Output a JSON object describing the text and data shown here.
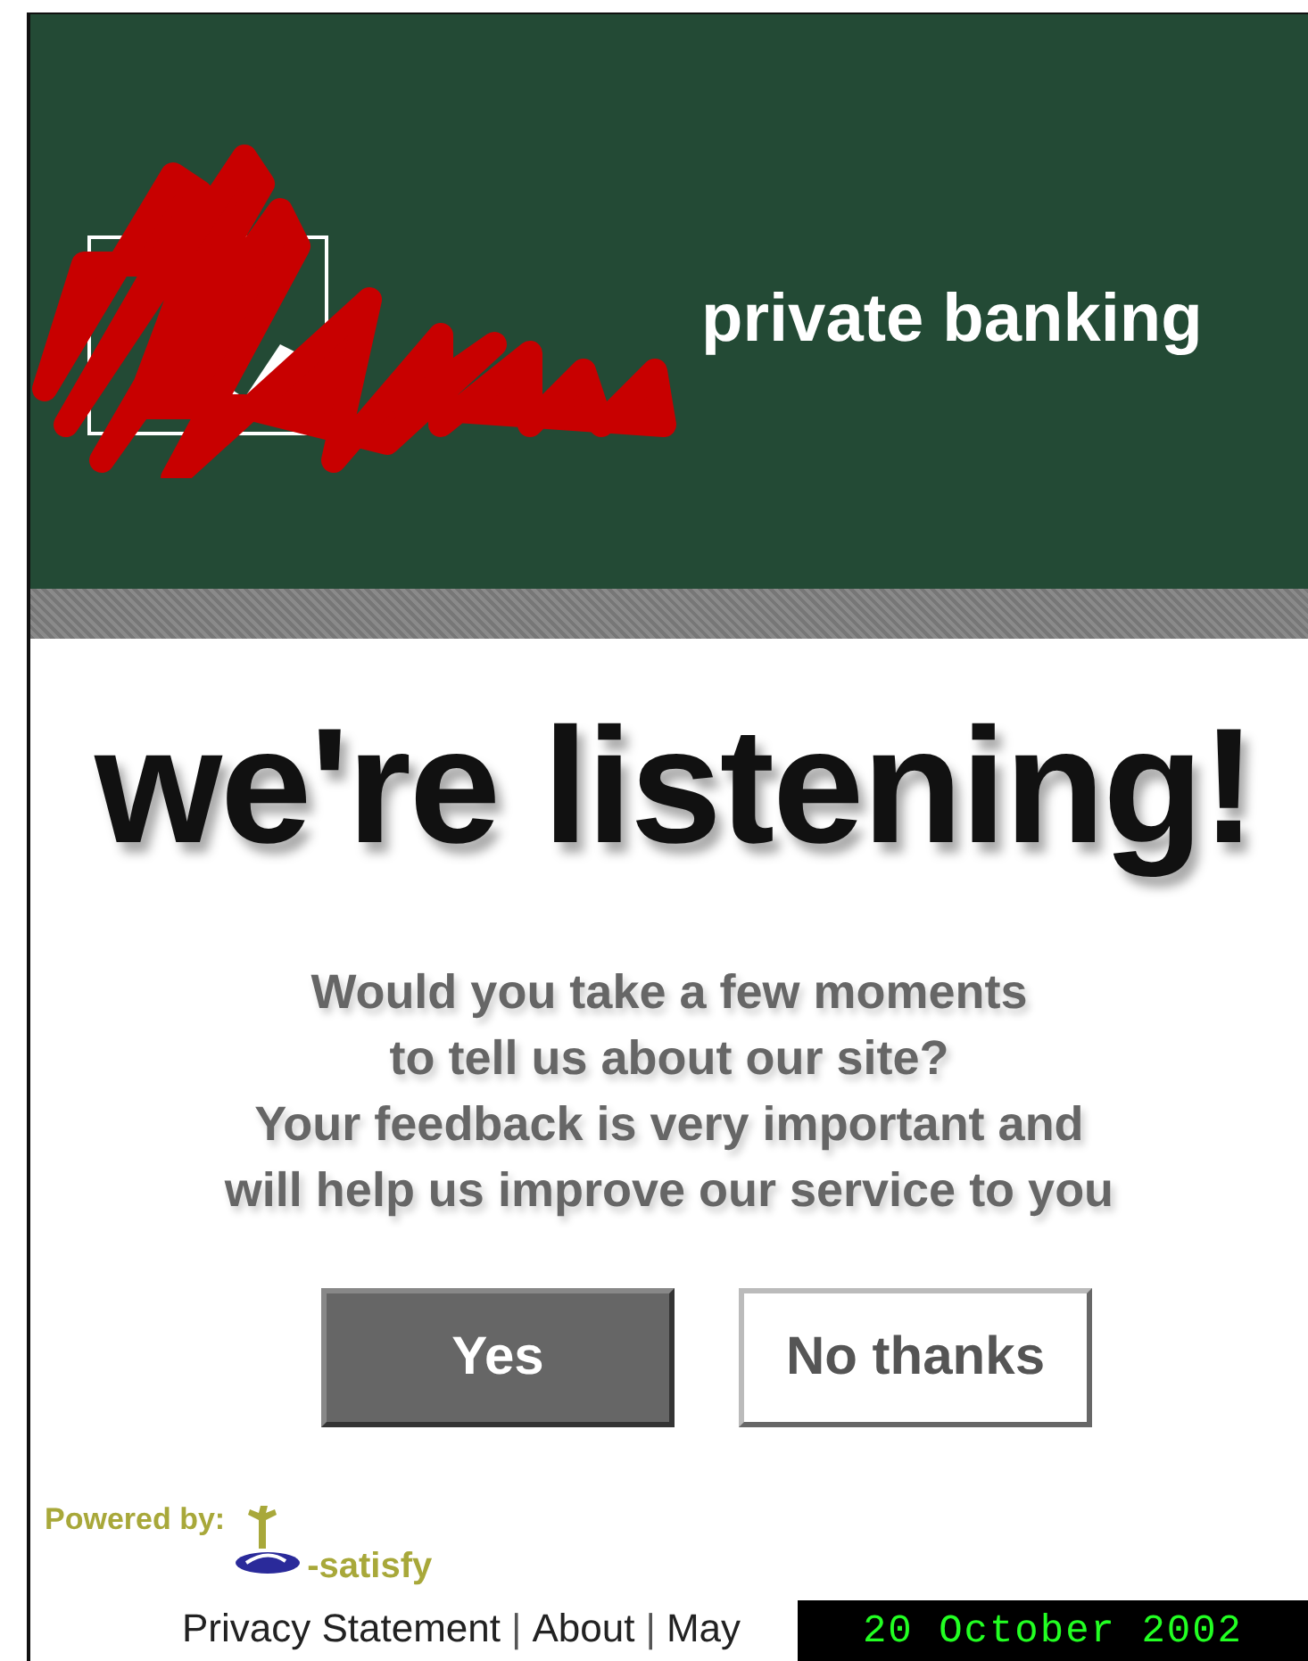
{
  "header": {
    "tagline": "private banking"
  },
  "heading": "we're listening!",
  "message_lines": [
    "Would you take a few moments",
    "to tell us about our site?",
    "Your feedback is very important and",
    "will help us improve our service to you"
  ],
  "buttons": [
    {
      "label": "Yes",
      "kind": "primary"
    },
    {
      "label": "No thanks",
      "kind": "secondary"
    }
  ],
  "powered_by": {
    "label": "Powered by:",
    "brand": "-satisfy"
  },
  "footer": {
    "links": [
      "Privacy Statement",
      "About",
      "May"
    ],
    "separator": "|"
  },
  "date_stamp": "20 October 2002"
}
